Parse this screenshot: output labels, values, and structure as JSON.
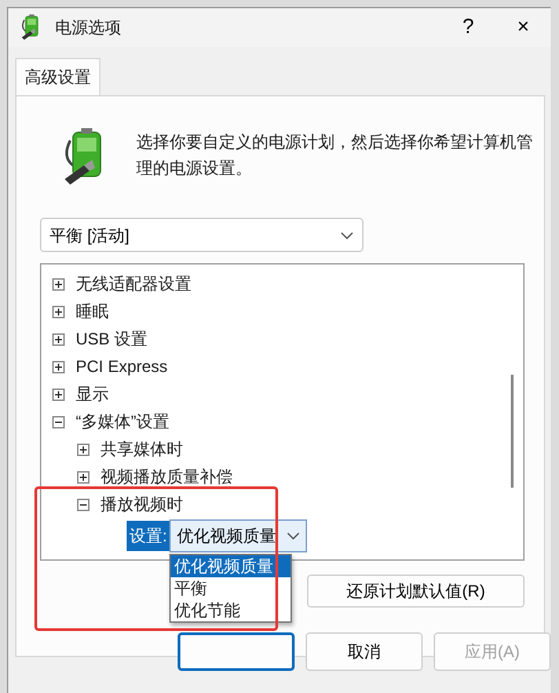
{
  "window": {
    "title": "电源选项",
    "help": "?",
    "close": "×"
  },
  "tabs": [
    {
      "label": "高级设置",
      "selected": true
    }
  ],
  "description": "选择你要自定义的电源计划，然后选择你希望计算机管理的电源设置。",
  "plan_select": {
    "value": "平衡 [活动]"
  },
  "tree": {
    "items": [
      {
        "label": "无线适配器设置",
        "expanded": false
      },
      {
        "label": "睡眠",
        "expanded": false
      },
      {
        "label": "USB 设置",
        "expanded": false
      },
      {
        "label": "PCI Express",
        "expanded": false
      },
      {
        "label": "显示",
        "expanded": false
      },
      {
        "label": "“多媒体”设置",
        "expanded": true,
        "children": [
          {
            "label": "共享媒体时",
            "expanded": false
          },
          {
            "label": "视频播放质量补偿",
            "expanded": false
          },
          {
            "label": "播放视频时",
            "expanded": true,
            "highlighted": true,
            "setting": {
              "label": "设置:",
              "value": "优化视频质量",
              "open": true,
              "options": [
                {
                  "label": "优化视频质量",
                  "selected": true
                },
                {
                  "label": "平衡",
                  "selected": false
                },
                {
                  "label": "优化节能",
                  "selected": false
                }
              ]
            }
          }
        ]
      }
    ]
  },
  "restore_button": "还原计划默认值(R)",
  "buttons": [
    {
      "kind": "default"
    },
    {
      "kind": "normal",
      "label": "取消",
      "disabled": false
    },
    {
      "kind": "normal",
      "label": "应用(A)",
      "disabled": true
    }
  ]
}
